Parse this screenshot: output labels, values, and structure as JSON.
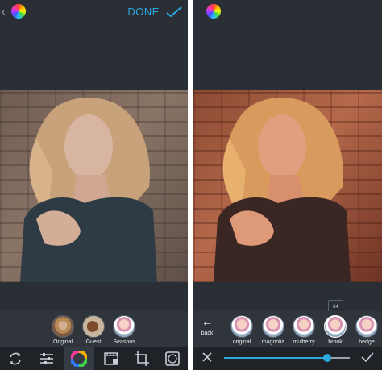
{
  "left": {
    "header": {
      "done_label": "DONE"
    },
    "filters": [
      {
        "label": "Original",
        "icon": "portrait-thumbnail"
      },
      {
        "label": "Guest",
        "icon": "horse-thumbnail"
      },
      {
        "label": "Seasons",
        "icon": "flower-thumbnail"
      }
    ],
    "tools": [
      {
        "name": "rotate-icon"
      },
      {
        "name": "adjust-sliders-icon"
      },
      {
        "name": "color-wheel-icon"
      },
      {
        "name": "film-strip-icon"
      },
      {
        "name": "crop-icon"
      },
      {
        "name": "vignette-icon"
      }
    ]
  },
  "right": {
    "back_label": "back",
    "filters": [
      {
        "label": "original"
      },
      {
        "label": "magnolia"
      },
      {
        "label": "mulberry"
      },
      {
        "label": "brook"
      },
      {
        "label": "hedge"
      }
    ],
    "strength_value": "64",
    "slider_level": 0.82
  },
  "colors": {
    "accent": "#2aa8e0",
    "panel_bg": "#2a2f35",
    "toolbar_bg": "#1f2328"
  }
}
